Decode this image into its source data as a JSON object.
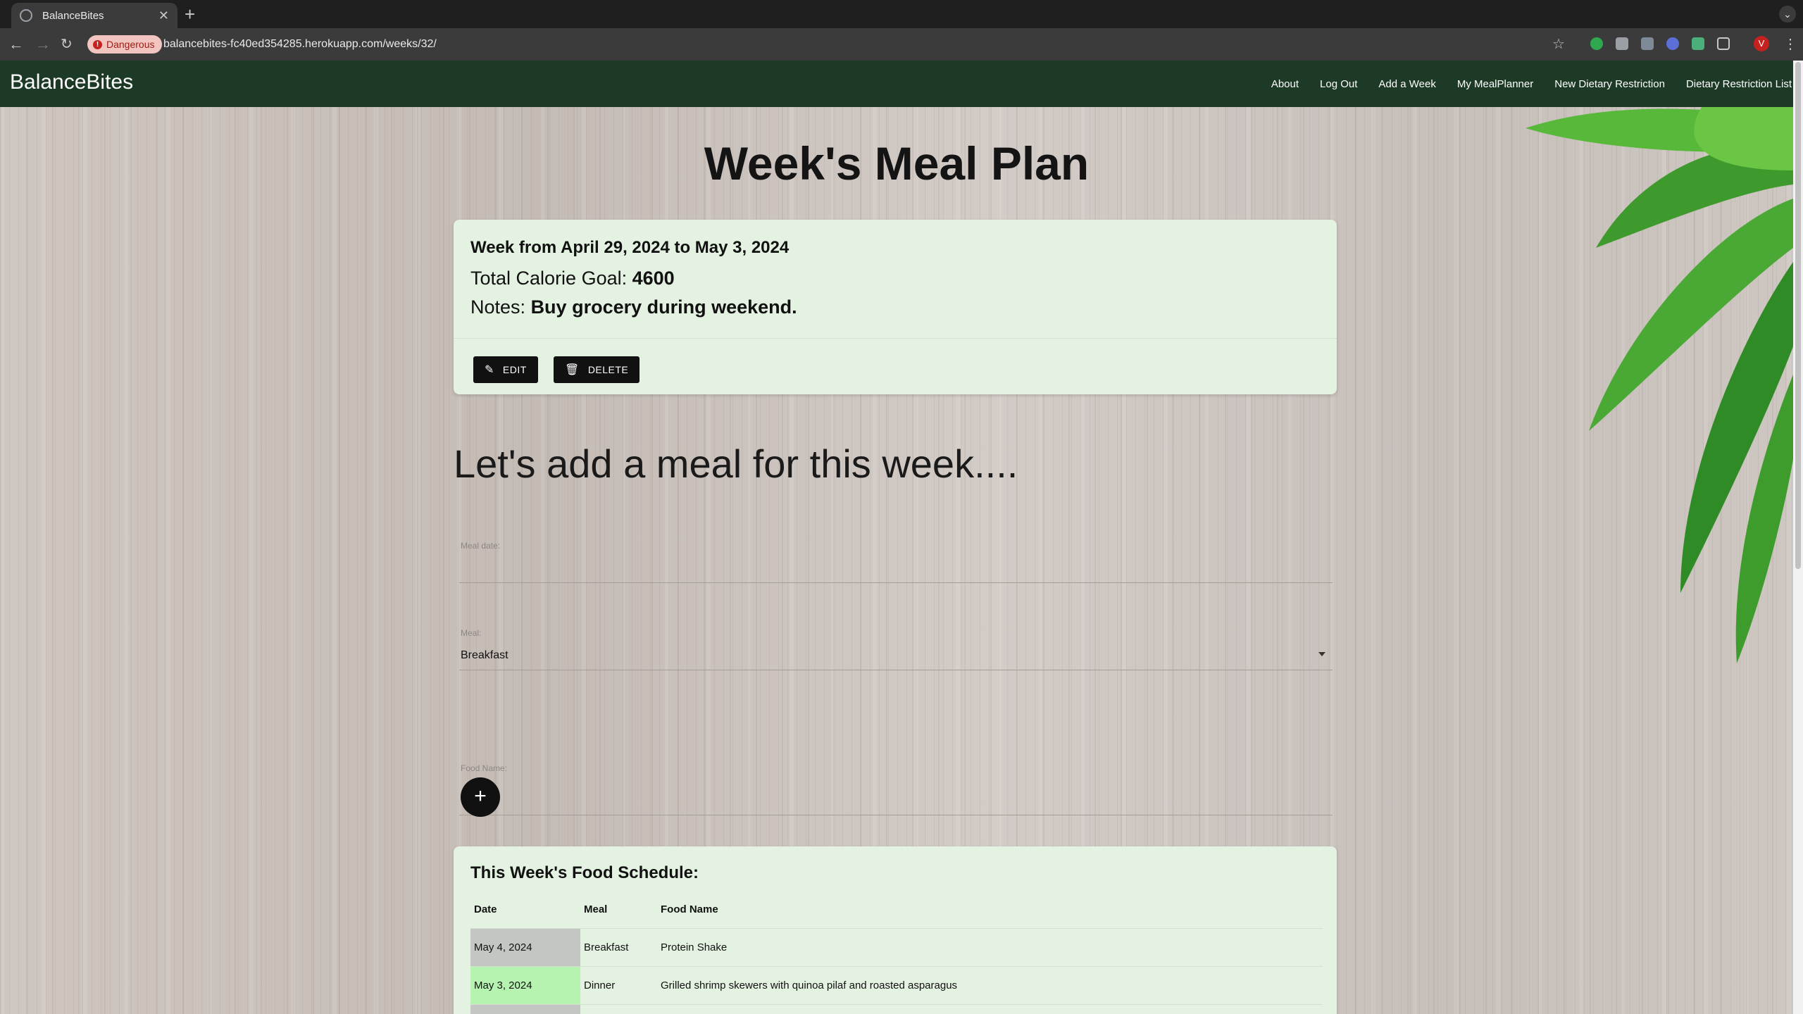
{
  "browser": {
    "tab_title": "BalanceBites",
    "security_chip": "Dangerous",
    "url": "balancebites-fc40ed354285.herokuapp.com/weeks/32/",
    "avatar_letter": "V"
  },
  "navbar": {
    "brand": "BalanceBites",
    "links": [
      "About",
      "Log Out",
      "Add a Week",
      "My MealPlanner",
      "New Dietary Restriction",
      "Dietary Restriction List"
    ]
  },
  "page": {
    "title": "Week's Meal Plan",
    "week": {
      "range": "Week from April 29, 2024 to May 3, 2024",
      "goal_label": "Total Calorie Goal:",
      "goal_value": "4600",
      "notes_label": "Notes:",
      "notes_value": "Buy grocery during weekend.",
      "edit_label": "EDIT",
      "delete_label": "DELETE"
    },
    "add_meal": {
      "heading": "Let's add a meal for this week....",
      "date_label": "Meal date:",
      "meal_label": "Meal:",
      "meal_value": "Breakfast",
      "food_label": "Food Name:",
      "add_button": "+"
    },
    "schedule": {
      "title": "This Week's Food Schedule:",
      "columns": [
        "Date",
        "Meal",
        "Food Name"
      ],
      "rows": [
        {
          "date": "May 4, 2024",
          "meal": "Breakfast",
          "food": "Protein Shake",
          "date_color": "#c3c6c2"
        },
        {
          "date": "May 3, 2024",
          "meal": "Dinner",
          "food": "Grilled shrimp skewers with quinoa pilaf and roasted asparagus",
          "date_color": "#b6f2b0"
        },
        {
          "date": "",
          "meal": "",
          "food": "",
          "date_color": "#c3c6c2"
        }
      ]
    }
  },
  "colors": {
    "navbar": "#1c3a26",
    "card": "#e4f2e1",
    "button": "#111111"
  }
}
